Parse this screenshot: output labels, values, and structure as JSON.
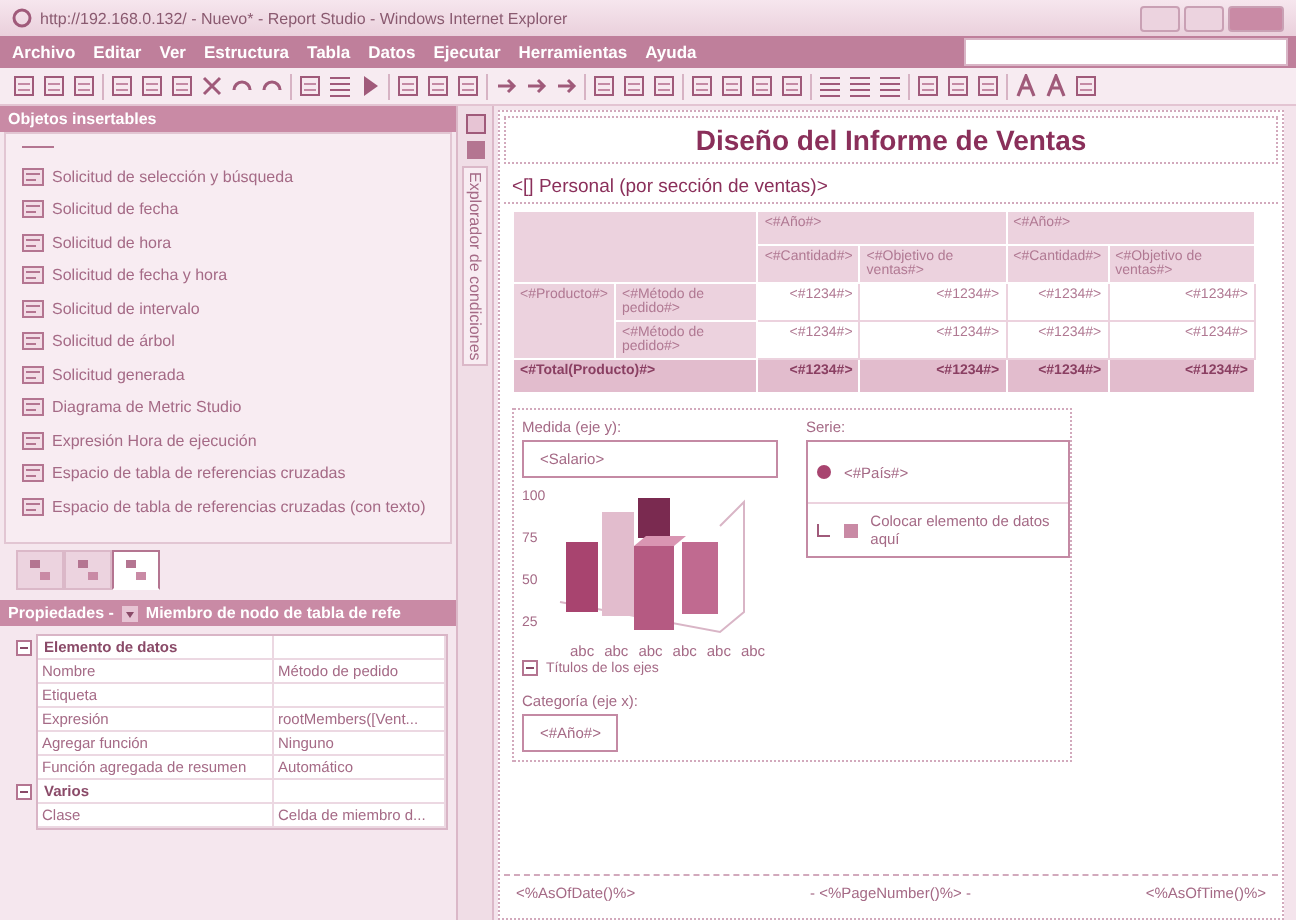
{
  "window": {
    "title": "http://192.168.0.132/ - Nuevo* - Report Studio - Windows Internet Explorer"
  },
  "menu": [
    "Archivo",
    "Editar",
    "Ver",
    "Estructura",
    "Tabla",
    "Datos",
    "Ejecutar",
    "Herramientas",
    "Ayuda"
  ],
  "insertable_objects": {
    "title": "Objetos insertables",
    "items": [
      {
        "label": "Solicitud de selección y búsqueda"
      },
      {
        "label": "Solicitud de fecha"
      },
      {
        "label": "Solicitud de hora"
      },
      {
        "label": "Solicitud de fecha y hora"
      },
      {
        "label": "Solicitud de intervalo"
      },
      {
        "label": "Solicitud de árbol"
      },
      {
        "label": "Solicitud generada"
      },
      {
        "label": "Diagrama de Metric Studio"
      },
      {
        "label": "Expresión Hora de ejecución"
      },
      {
        "label": "Espacio de tabla de referencias cruzadas"
      },
      {
        "label": "Espacio de tabla de referencias cruzadas (con texto)"
      }
    ]
  },
  "panel_tabs": [
    {
      "selected": false
    },
    {
      "selected": false
    },
    {
      "selected": true
    }
  ],
  "side_tab": "Explorador de condiciones",
  "properties": {
    "title": "Propiedades - ",
    "subtitle": "Miembro de nodo de tabla de refe",
    "rows": [
      {
        "kind": "group",
        "name": "Elemento de datos",
        "expanded": true
      },
      {
        "kind": "property",
        "name": "Nombre",
        "value": "Método de pedido"
      },
      {
        "kind": "property",
        "name": "Etiqueta",
        "value": ""
      },
      {
        "kind": "property",
        "name": "Expresión",
        "value": "rootMembers([Vent..."
      },
      {
        "kind": "property",
        "name": "Agregar función",
        "value": "Ninguno"
      },
      {
        "kind": "property",
        "name": "Función agregada de resumen",
        "value": "Automático"
      },
      {
        "kind": "group",
        "name": "Varios",
        "expanded": true
      },
      {
        "kind": "property",
        "name": "Clase",
        "value": "Celda de miembro d..."
      }
    ]
  },
  "report": {
    "title": "Diseño del Informe de Ventas",
    "crosstab": {
      "title": "<[] Personal (por sección de ventas)>",
      "column_groups": [
        "<#Año#>",
        "<#Año#>"
      ],
      "column_headers": [
        "<#Cantidad#>",
        "<#Objetivo de ventas#>",
        "<#Cantidad#>",
        "<#Objetivo de ventas#>"
      ],
      "row_header": "<#Producto#>",
      "rows": [
        {
          "label": "<#Método de pedido#>",
          "cells": [
            "<#1234#>",
            "<#1234#>",
            "<#1234#>",
            "<#1234#>"
          ]
        },
        {
          "label": "<#Método de pedido#>",
          "cells": [
            "<#1234#>",
            "<#1234#>",
            "<#1234#>",
            "<#1234#>"
          ]
        }
      ],
      "total": {
        "label": "<#Total(Producto)#>",
        "cells": [
          "<#1234#>",
          "<#1234#>",
          "<#1234#>",
          "<#1234#>"
        ]
      }
    },
    "chart": {
      "measure_label": "Medida (eje y):",
      "measure": "<Salario>",
      "yticks": [
        "100",
        "75",
        "50",
        "25"
      ],
      "categories": [
        "abc",
        "abc",
        "abc",
        "abc",
        "abc",
        "abc"
      ],
      "axis_titles": {
        "label": "Títulos de los ejes",
        "expanded": true
      },
      "category_label": "Categoría (eje x):",
      "category": "<#Año#>",
      "series_label": "Serie:",
      "series": "<#País#>",
      "drop_hint": "Colocar elemento de datos aquí"
    },
    "footer": [
      "<%AsOfDate()%>",
      "- <%PageNumber()%> -",
      "<%AsOfTime()%>"
    ]
  }
}
